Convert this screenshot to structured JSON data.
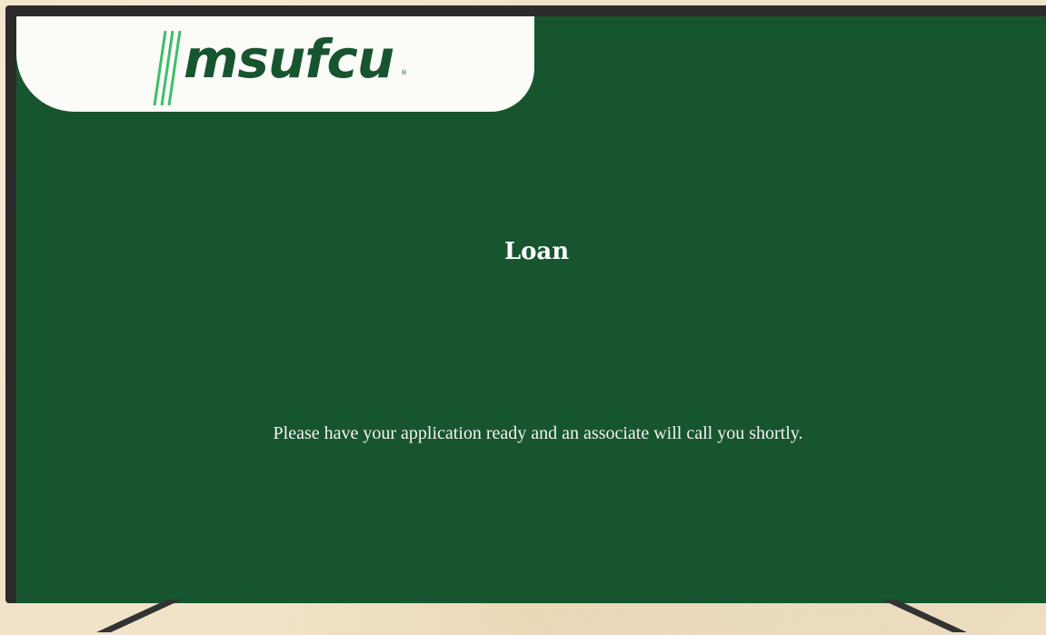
{
  "brand": {
    "logo_text": "msufcu",
    "registered_mark": "®",
    "primary_color": "#17552f",
    "accent_color": "#3fbf6a"
  },
  "main": {
    "title": "Loan",
    "message": "Please have your application ready and an associate will call you shortly."
  }
}
